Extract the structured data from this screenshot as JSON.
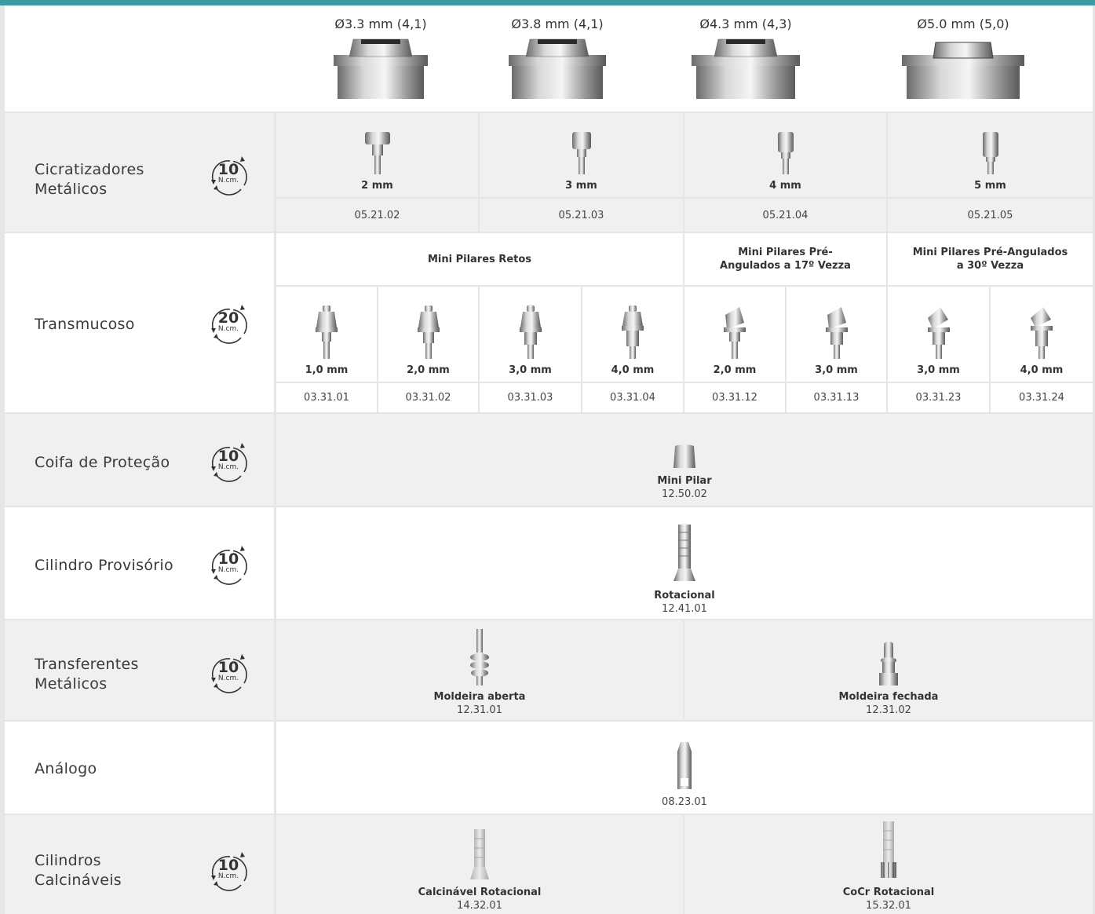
{
  "header": {
    "sizes": [
      "Ø3.3 mm (4,1)",
      "Ø3.8 mm (4,1)",
      "Ø4.3 mm (4,3)",
      "Ø5.0 mm (5,0)"
    ]
  },
  "rows": {
    "cicatrizadores": {
      "label": "Cicratizadores Metálicos",
      "torque": "10",
      "unit": "N.cm.",
      "items": [
        {
          "size": "2 mm",
          "code": "05.21.02"
        },
        {
          "size": "3 mm",
          "code": "05.21.03"
        },
        {
          "size": "4 mm",
          "code": "05.21.04"
        },
        {
          "size": "5 mm",
          "code": "05.21.05"
        }
      ]
    },
    "transmucoso": {
      "label": "Transmucoso",
      "torque": "20",
      "unit": "N.cm.",
      "groups": [
        "Mini Pilares Retos",
        "Mini Pilares Pré-Angulados a 17º Vezza",
        "Mini Pilares Pré-Angulados a 30º Vezza"
      ],
      "items": [
        {
          "size": "1,0 mm",
          "code": "03.31.01"
        },
        {
          "size": "2,0 mm",
          "code": "03.31.02"
        },
        {
          "size": "3,0 mm",
          "code": "03.31.03"
        },
        {
          "size": "4,0 mm",
          "code": "03.31.04"
        },
        {
          "size": "2,0 mm",
          "code": "03.31.12"
        },
        {
          "size": "3,0 mm",
          "code": "03.31.13"
        },
        {
          "size": "3,0 mm",
          "code": "03.31.23"
        },
        {
          "size": "4,0 mm",
          "code": "03.31.24"
        }
      ]
    },
    "coifa": {
      "label": "Coifa de Proteção",
      "torque": "10",
      "unit": "N.cm.",
      "name": "Mini Pilar",
      "code": "12.50.02"
    },
    "cilindro_provisorio": {
      "label": "Cilindro Provisório",
      "torque": "10",
      "unit": "N.cm.",
      "name": "Rotacional",
      "code": "12.41.01"
    },
    "transferentes": {
      "label": "Transferentes Metálicos",
      "torque": "10",
      "unit": "N.cm.",
      "items": [
        {
          "name": "Moldeira aberta",
          "code": "12.31.01"
        },
        {
          "name": "Moldeira fechada",
          "code": "12.31.02"
        }
      ]
    },
    "analogo": {
      "label": "Análogo",
      "code": "08.23.01"
    },
    "calcinaveis": {
      "label": "Cilindros Calcináveis",
      "torque": "10",
      "unit": "N.cm.",
      "items": [
        {
          "name": "Calcinável Rotacional",
          "code": "14.32.01"
        },
        {
          "name": "CoCr Rotacional",
          "code": "15.32.01"
        }
      ]
    }
  }
}
